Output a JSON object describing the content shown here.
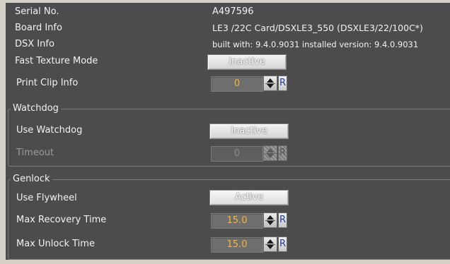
{
  "info": {
    "serial_label": "Serial No.",
    "serial_value": "A497596",
    "board_label": "Board Info",
    "board_value": "LE3 /22C Card/DSXLE3_550 (DSXLE3/22/100C*)",
    "dsx_label": "DSX Info",
    "dsx_value": "built with: 9.4.0.9031 installed version: 9.4.0.9031"
  },
  "fast_texture": {
    "label": "Fast Texture Mode",
    "button": "Inactive"
  },
  "print_clip": {
    "label": "Print Clip Info",
    "value": "0",
    "reset": "R"
  },
  "watchdog": {
    "title": "Watchdog",
    "use_label": "Use Watchdog",
    "use_button": "Inactive",
    "timeout_label": "Timeout",
    "timeout_value": "0",
    "reset": "R"
  },
  "genlock": {
    "title": "Genlock",
    "flywheel_label": "Use Flywheel",
    "flywheel_button": "Active",
    "recovery_label": "Max Recovery Time",
    "recovery_value": "15.0",
    "unlock_label": "Max Unlock Time",
    "unlock_value": "15.0",
    "reset": "R"
  },
  "colors": {
    "panel_bg": "#4c4c4c",
    "value_text": "#f5b63c",
    "reset_letter": "#1e3f9a"
  },
  "icons": [
    "spin-up-down-icon"
  ]
}
